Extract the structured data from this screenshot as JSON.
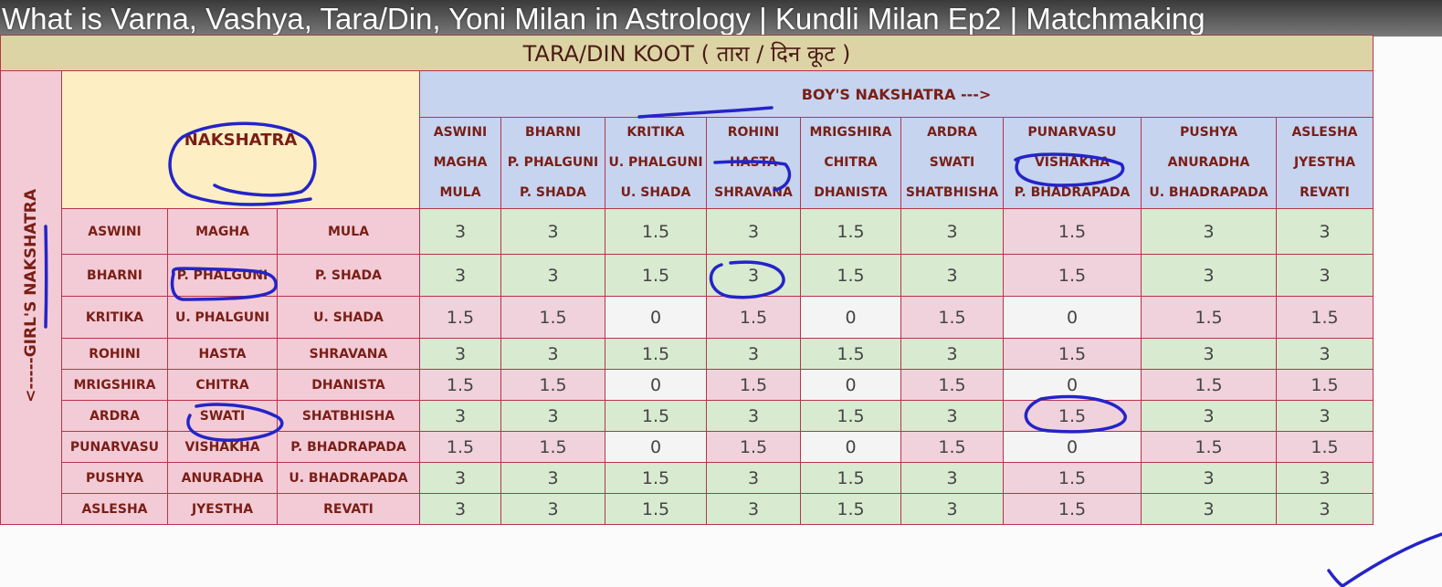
{
  "video_title": "What is Varna, Vashya, Tara/Din, Yoni Milan in Astrology | Kundli Milan Ep2 | Matchmaking",
  "table": {
    "title": "TARA/DIN KOOT ( तारा / दिन  कूट )",
    "boy_header": "BOY'S NAKSHATRA --->",
    "girl_header": "<-----GIRL'S NAKSHATRA",
    "corner_label": "NAKSHATRA",
    "columns": [
      [
        "ASWINI",
        "MAGHA",
        "MULA"
      ],
      [
        "BHARNI",
        "P. PHALGUNI",
        "P. SHADA"
      ],
      [
        "KRITIKA",
        "U. PHALGUNI",
        "U. SHADA"
      ],
      [
        "ROHINI",
        "HASTA",
        "SHRAVANA"
      ],
      [
        "MRIGSHIRA",
        "CHITRA",
        "DHANISTA"
      ],
      [
        "ARDRA",
        "SWATI",
        "SHATBHISHA"
      ],
      [
        "PUNARVASU",
        "VISHAKHA",
        "P. BHADRAPADA"
      ],
      [
        "PUSHYA",
        "ANURADHA",
        "U. BHADRAPADA"
      ],
      [
        "ASLESHA",
        "JYESTHA",
        "REVATI"
      ]
    ],
    "rows": [
      {
        "names": [
          "ASWINI",
          "MAGHA",
          "MULA"
        ],
        "values": [
          "3",
          "3",
          "1.5",
          "3",
          "1.5",
          "3",
          "1.5",
          "3",
          "3"
        ]
      },
      {
        "names": [
          "BHARNI",
          "P. PHALGUNI",
          "P. SHADA"
        ],
        "values": [
          "3",
          "3",
          "1.5",
          "3",
          "1.5",
          "3",
          "1.5",
          "3",
          "3"
        ]
      },
      {
        "names": [
          "KRITIKA",
          "U. PHALGUNI",
          "U. SHADA"
        ],
        "values": [
          "1.5",
          "1.5",
          "0",
          "1.5",
          "0",
          "1.5",
          "0",
          "1.5",
          "1.5"
        ]
      },
      {
        "names": [
          "ROHINI",
          "HASTA",
          "SHRAVANA"
        ],
        "values": [
          "3",
          "3",
          "1.5",
          "3",
          "1.5",
          "3",
          "1.5",
          "3",
          "3"
        ]
      },
      {
        "names": [
          "MRIGSHIRA",
          "CHITRA",
          "DHANISTA"
        ],
        "values": [
          "1.5",
          "1.5",
          "0",
          "1.5",
          "0",
          "1.5",
          "0",
          "1.5",
          "1.5"
        ]
      },
      {
        "names": [
          "ARDRA",
          "SWATI",
          "SHATBHISHA"
        ],
        "values": [
          "3",
          "3",
          "1.5",
          "3",
          "1.5",
          "3",
          "1.5",
          "3",
          "3"
        ]
      },
      {
        "names": [
          "PUNARVASU",
          "VISHAKHA",
          "P. BHADRAPADA"
        ],
        "values": [
          "1.5",
          "1.5",
          "0",
          "1.5",
          "0",
          "1.5",
          "0",
          "1.5",
          "1.5"
        ]
      },
      {
        "names": [
          "PUSHYA",
          "ANURADHA",
          "U. BHADRAPADA"
        ],
        "values": [
          "3",
          "3",
          "1.5",
          "3",
          "1.5",
          "3",
          "1.5",
          "3",
          "3"
        ]
      },
      {
        "names": [
          "ASLESHA",
          "JYESTHA",
          "REVATI"
        ],
        "values": [
          "3",
          "3",
          "1.5",
          "3",
          "1.5",
          "3",
          "1.5",
          "3",
          "3"
        ]
      }
    ]
  },
  "colors": {
    "title_bg": "#ddd4a6",
    "header_blue": "#c6d4ef",
    "header_yellow": "#fdeec4",
    "row_pink": "#f2cbd6",
    "cell_green": "#d8ebd0",
    "cell_pink": "#f0d2dc",
    "cell_white": "#f4f4f4",
    "border": "#b5354b",
    "pen": "#2424c8"
  }
}
